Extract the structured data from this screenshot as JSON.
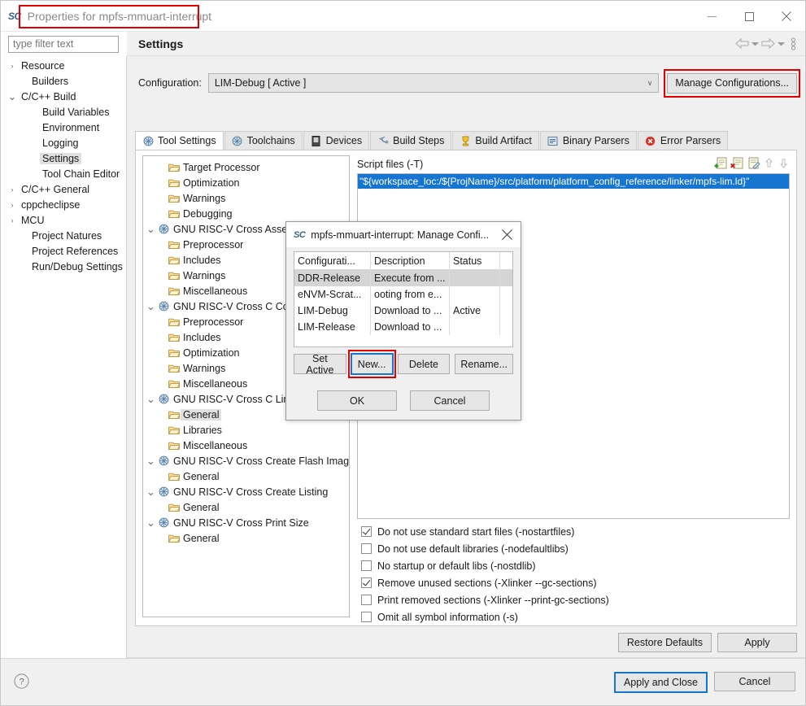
{
  "window": {
    "logo": "SC",
    "title": "Properties for mpfs-mmuart-interrupt",
    "minimize": "–",
    "maximize": "□",
    "close": "✕"
  },
  "header": {
    "page_title": "Settings",
    "filter_placeholder": "type filter text",
    "filter_value": ""
  },
  "sidebar": {
    "items": [
      {
        "label": "Resource",
        "arrow": "›",
        "indent": 0,
        "selected": false
      },
      {
        "label": "Builders",
        "arrow": "",
        "indent": 1,
        "selected": false
      },
      {
        "label": "C/C++ Build",
        "arrow": "∨",
        "indent": 0,
        "selected": false
      },
      {
        "label": "Build Variables",
        "arrow": "",
        "indent": 2,
        "selected": false
      },
      {
        "label": "Environment",
        "arrow": "",
        "indent": 2,
        "selected": false
      },
      {
        "label": "Logging",
        "arrow": "",
        "indent": 2,
        "selected": false
      },
      {
        "label": "Settings",
        "arrow": "",
        "indent": 2,
        "selected": true
      },
      {
        "label": "Tool Chain Editor",
        "arrow": "",
        "indent": 2,
        "selected": false
      },
      {
        "label": "C/C++ General",
        "arrow": "›",
        "indent": 0,
        "selected": false
      },
      {
        "label": "cppcheclipse",
        "arrow": "›",
        "indent": 0,
        "selected": false
      },
      {
        "label": "MCU",
        "arrow": "›",
        "indent": 0,
        "selected": false
      },
      {
        "label": "Project Natures",
        "arrow": "",
        "indent": 1,
        "selected": false
      },
      {
        "label": "Project References",
        "arrow": "",
        "indent": 1,
        "selected": false
      },
      {
        "label": "Run/Debug Settings",
        "arrow": "",
        "indent": 1,
        "selected": false
      }
    ]
  },
  "config": {
    "label": "Configuration:",
    "value": "LIM-Debug  [ Active ]",
    "caret": "∨",
    "manage_button": "Manage Configurations...",
    "highlight_color": "#e00000"
  },
  "tabs": [
    {
      "label": "Tool Settings",
      "icon": "tool-settings-icon",
      "active": true
    },
    {
      "label": "Toolchains",
      "icon": "toolchains-icon",
      "active": false
    },
    {
      "label": "Devices",
      "icon": "devices-icon",
      "active": false
    },
    {
      "label": "Build Steps",
      "icon": "build-steps-icon",
      "active": false
    },
    {
      "label": "Build Artifact",
      "icon": "build-artifact-icon",
      "active": false
    },
    {
      "label": "Binary Parsers",
      "icon": "binary-parsers-icon",
      "active": false
    },
    {
      "label": "Error Parsers",
      "icon": "error-parsers-icon",
      "active": false
    }
  ],
  "tool_tree": [
    {
      "label": "Target Processor",
      "type": "leaf",
      "arrow": "",
      "selected": false
    },
    {
      "label": "Optimization",
      "type": "leaf",
      "arrow": "",
      "selected": false
    },
    {
      "label": "Warnings",
      "type": "leaf",
      "arrow": "",
      "selected": false
    },
    {
      "label": "Debugging",
      "type": "leaf",
      "arrow": "",
      "selected": false
    },
    {
      "label": "GNU RISC-V Cross Assembler",
      "type": "group",
      "arrow": "∨",
      "selected": false
    },
    {
      "label": "Preprocessor",
      "type": "leaf",
      "arrow": "",
      "selected": false
    },
    {
      "label": "Includes",
      "type": "leaf",
      "arrow": "",
      "selected": false
    },
    {
      "label": "Warnings",
      "type": "leaf",
      "arrow": "",
      "selected": false
    },
    {
      "label": "Miscellaneous",
      "type": "leaf",
      "arrow": "",
      "selected": false
    },
    {
      "label": "GNU RISC-V Cross C Compiler",
      "type": "group",
      "arrow": "∨",
      "selected": false
    },
    {
      "label": "Preprocessor",
      "type": "leaf",
      "arrow": "",
      "selected": false
    },
    {
      "label": "Includes",
      "type": "leaf",
      "arrow": "",
      "selected": false
    },
    {
      "label": "Optimization",
      "type": "leaf",
      "arrow": "",
      "selected": false
    },
    {
      "label": "Warnings",
      "type": "leaf",
      "arrow": "",
      "selected": false
    },
    {
      "label": "Miscellaneous",
      "type": "leaf",
      "arrow": "",
      "selected": false
    },
    {
      "label": "GNU RISC-V Cross C Linker",
      "type": "group",
      "arrow": "∨",
      "selected": false
    },
    {
      "label": "General",
      "type": "leaf",
      "arrow": "",
      "selected": true
    },
    {
      "label": "Libraries",
      "type": "leaf",
      "arrow": "",
      "selected": false
    },
    {
      "label": "Miscellaneous",
      "type": "leaf",
      "arrow": "",
      "selected": false
    },
    {
      "label": "GNU RISC-V Cross Create Flash Image",
      "type": "group",
      "arrow": "∨",
      "selected": false
    },
    {
      "label": "General",
      "type": "leaf",
      "arrow": "",
      "selected": false
    },
    {
      "label": "GNU RISC-V Cross Create Listing",
      "type": "group",
      "arrow": "∨",
      "selected": false
    },
    {
      "label": "General",
      "type": "leaf",
      "arrow": "",
      "selected": false
    },
    {
      "label": "GNU RISC-V Cross Print Size",
      "type": "group",
      "arrow": "∨",
      "selected": false
    },
    {
      "label": "General",
      "type": "leaf",
      "arrow": "",
      "selected": false
    }
  ],
  "script_files": {
    "title": "Script files (-T)",
    "toolbar": [
      "add-script-icon",
      "delete-script-icon",
      "edit-script-icon",
      "move-up-icon",
      "move-down-icon"
    ],
    "entries": [
      "\"${workspace_loc:/${ProjName}/src/platform/platform_config_reference/linker/mpfs-lim.ld}\""
    ],
    "selection_color": "#1675d1"
  },
  "linker_options": [
    {
      "label": "Do not use standard start files (-nostartfiles)",
      "checked": true
    },
    {
      "label": "Do not use default libraries (-nodefaultlibs)",
      "checked": false
    },
    {
      "label": "No startup or default libs (-nostdlib)",
      "checked": false
    },
    {
      "label": "Remove unused sections (-Xlinker --gc-sections)",
      "checked": true
    },
    {
      "label": "Print removed sections (-Xlinker --print-gc-sections)",
      "checked": false
    },
    {
      "label": "Omit all symbol information (-s)",
      "checked": false
    }
  ],
  "page_buttons": {
    "restore_defaults": "Restore Defaults",
    "apply": "Apply"
  },
  "footer": {
    "help_icon": "help-icon",
    "apply_and_close": "Apply and Close",
    "cancel": "Cancel"
  },
  "modal": {
    "logo": "SC",
    "title": "mpfs-mmuart-interrupt: Manage Confi...",
    "close": "✕",
    "columns": [
      "Configurati...",
      "Description",
      "Status"
    ],
    "rows": [
      {
        "name": "DDR-Release",
        "description": "Execute from ...",
        "status": "",
        "selected": true
      },
      {
        "name": "eNVM-Scrat...",
        "description": "ooting from e...",
        "status": "",
        "selected": false
      },
      {
        "name": "LIM-Debug",
        "description": "Download to ...",
        "status": "Active",
        "selected": false
      },
      {
        "name": "LIM-Release",
        "description": "Download to ...",
        "status": "",
        "selected": false
      }
    ],
    "actions": [
      {
        "label": "Set Active",
        "focused": false,
        "highlighted": false
      },
      {
        "label": "New...",
        "focused": true,
        "highlighted": true
      },
      {
        "label": "Delete",
        "focused": false,
        "highlighted": false
      },
      {
        "label": "Rename...",
        "focused": false,
        "highlighted": false
      }
    ],
    "ok": "OK",
    "cancel": "Cancel",
    "highlight_color": "#e00000"
  }
}
